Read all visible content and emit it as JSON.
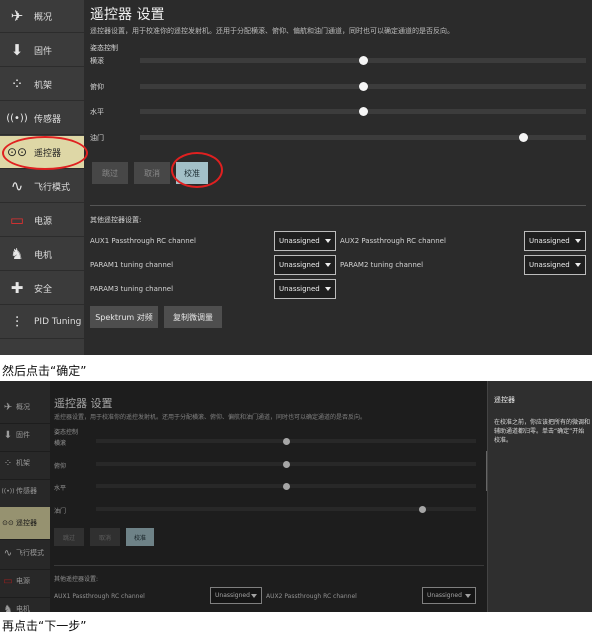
{
  "sidebar": [
    {
      "key": "overview",
      "label": "概况",
      "icon": "✈"
    },
    {
      "key": "frame",
      "label": "固件",
      "icon": "⬇"
    },
    {
      "key": "airframe",
      "label": "机架",
      "icon": "⁘"
    },
    {
      "key": "sensors",
      "label": "传感器",
      "icon": "((•))"
    },
    {
      "key": "radio",
      "label": "遥控器",
      "icon": "⊙⊙"
    },
    {
      "key": "flight_modes",
      "label": "飞行模式",
      "icon": "∿"
    },
    {
      "key": "power",
      "label": "电源",
      "icon": "▭"
    },
    {
      "key": "motors",
      "label": "电机",
      "icon": "♞"
    },
    {
      "key": "safety",
      "label": "安全",
      "icon": "✚"
    },
    {
      "key": "pid",
      "label": "PID Tuning",
      "icon": "⫶"
    }
  ],
  "page": {
    "title": "遥控器 设置",
    "description": "遥控器设置，用于校准你的遥控发射机。还用于分配横滚、俯仰、偏航和油门通道，同时也可以确定通道的是否反向。",
    "attitude_label": "姿态控制",
    "channels": [
      {
        "label": "横滚",
        "value": 0.5
      },
      {
        "label": "俯仰",
        "value": 0.5
      },
      {
        "label": "水平",
        "value": 0.5
      },
      {
        "label": "油门",
        "value": 0.86
      }
    ],
    "buttons": {
      "skip": "跳过",
      "cancel": "取消",
      "calibrate": "校准"
    },
    "other_label": "其他遥控器设置:",
    "params": [
      {
        "label": "AUX1 Passthrough RC channel",
        "value": "Unassigned"
      },
      {
        "label": "AUX2 Passthrough RC channel",
        "value": "Unassigned"
      },
      {
        "label": "PARAM1 tuning channel",
        "value": "Unassigned"
      },
      {
        "label": "PARAM2 tuning channel",
        "value": "Unassigned"
      },
      {
        "label": "PARAM3 tuning channel",
        "value": "Unassigned"
      }
    ],
    "bottom_buttons": {
      "spektrum": "Spektrum 对频",
      "copy": "复制微调量"
    }
  },
  "caption1": "然后点击“确定”",
  "caption2": "再点击“下一步”",
  "dialog": {
    "header": "遥控器",
    "body": "在校准之前，你应该把所有的微调和辅助通道都归零。单击“确定”开始校准。"
  },
  "colors": {
    "active_sidebar": "#ded7a6",
    "calibrate_button": "#a3c0c8",
    "annotation": "#e02020"
  }
}
